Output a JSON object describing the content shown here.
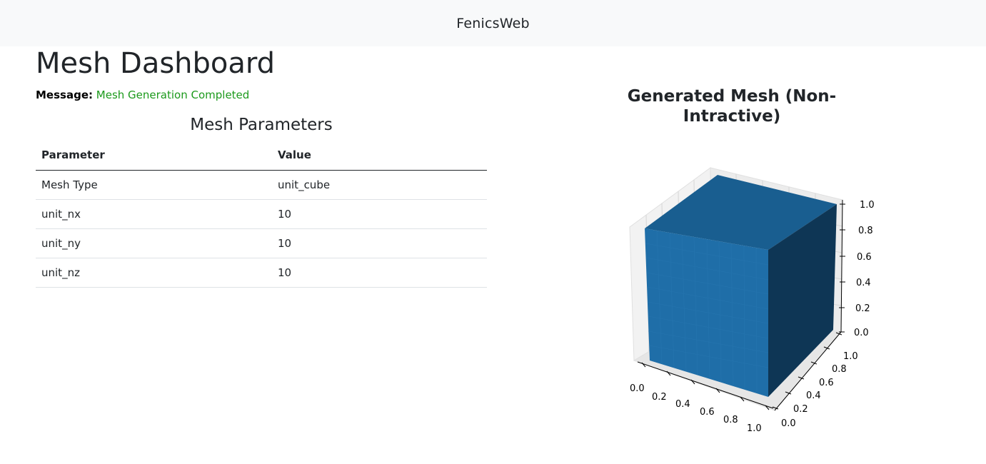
{
  "navbar": {
    "brand": "FenicsWeb"
  },
  "page": {
    "title": "Mesh Dashboard"
  },
  "message": {
    "label": "Message:",
    "text": "Mesh Generation Completed"
  },
  "parameters": {
    "title": "Mesh Parameters",
    "headers": [
      "Parameter",
      "Value"
    ],
    "rows": [
      [
        "Mesh Type",
        "unit_cube"
      ],
      [
        "unit_nx",
        "10"
      ],
      [
        "unit_ny",
        "10"
      ],
      [
        "unit_nz",
        "10"
      ]
    ]
  },
  "plot": {
    "title": "Generated Mesh (Non-Intractive)",
    "x_ticks": [
      "0.0",
      "0.2",
      "0.4",
      "0.6",
      "0.8",
      "1.0"
    ],
    "y_ticks": [
      "0.0",
      "0.2",
      "0.4",
      "0.6",
      "0.8",
      "1.0"
    ],
    "z_ticks": [
      "0.0",
      "0.2",
      "0.4",
      "0.6",
      "0.8",
      "1.0"
    ],
    "colors": {
      "front": "#1f6ea8",
      "top": "#195e90",
      "side": "#0e3655"
    }
  }
}
